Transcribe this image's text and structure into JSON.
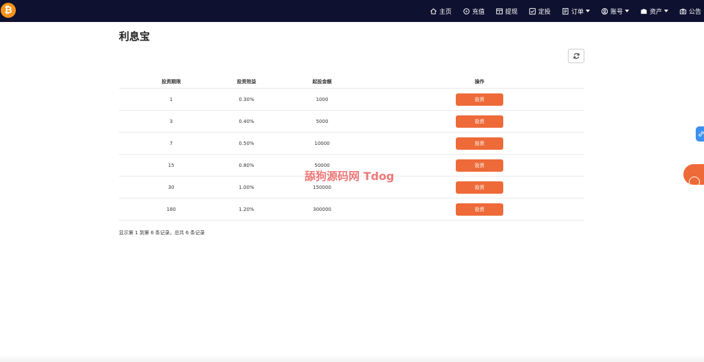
{
  "header": {
    "logo_text": "₿",
    "nav": [
      {
        "label": "主页",
        "icon": "home-icon",
        "caret": false
      },
      {
        "label": "充值",
        "icon": "recharge-icon",
        "caret": false
      },
      {
        "label": "提现",
        "icon": "withdraw-icon",
        "caret": false
      },
      {
        "label": "定投",
        "icon": "fixed-invest-icon",
        "caret": false
      },
      {
        "label": "订单",
        "icon": "order-icon",
        "caret": true
      },
      {
        "label": "账号",
        "icon": "user-icon",
        "caret": true
      },
      {
        "label": "资产",
        "icon": "wallet-icon",
        "caret": true
      },
      {
        "label": "公告",
        "icon": "camera-icon",
        "caret": false
      }
    ]
  },
  "page": {
    "title": "利息宝"
  },
  "table": {
    "headers": [
      "投资期限",
      "投资效益",
      "起投金额",
      "操作"
    ],
    "rows": [
      {
        "term": "1",
        "yield": "0.30%",
        "min_amount": "1000",
        "action": "投资"
      },
      {
        "term": "3",
        "yield": "0.40%",
        "min_amount": "5000",
        "action": "投资"
      },
      {
        "term": "7",
        "yield": "0.50%",
        "min_amount": "10000",
        "action": "投资"
      },
      {
        "term": "15",
        "yield": "0.80%",
        "min_amount": "50000",
        "action": "投资"
      },
      {
        "term": "30",
        "yield": "1.00%",
        "min_amount": "150000",
        "action": "投资"
      },
      {
        "term": "180",
        "yield": "1.20%",
        "min_amount": "300000",
        "action": "投资"
      }
    ]
  },
  "pagination": {
    "info": "显示第 1 到第 6 条记录，总共 6 条记录"
  },
  "watermark": "舔狗源码网 Tdog",
  "colors": {
    "navbar_bg": "#0e1230",
    "accent": "#ee6a38",
    "logo": "#f7931a",
    "float_blue": "#3d8ff0"
  }
}
